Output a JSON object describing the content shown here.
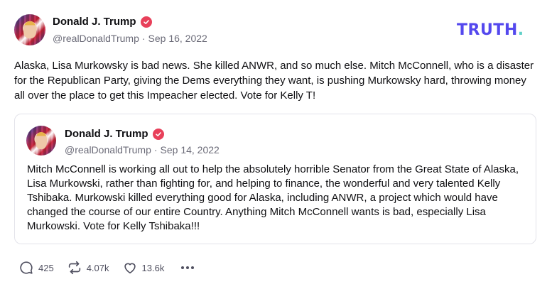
{
  "post": {
    "author_name": "Donald J. Trump",
    "handle": "@realDonaldTrump",
    "separator": "·",
    "date": "Sep 16, 2022",
    "text": "Alaska, Lisa Murkowsky is bad news. She killed ANWR, and so much else. Mitch McConnell, who is a disaster for the Republican Party, giving the Dems everything they want, is pushing Murkowsky hard, throwing money all over the place to get this Impeacher elected. Vote for Kelly T!"
  },
  "brand": {
    "logo_text": "TRUTH",
    "logo_dot": ".",
    "logo_color": "#5448ee",
    "dot_color": "#5fd0c8"
  },
  "quoted_post": {
    "author_name": "Donald J. Trump",
    "handle": "@realDonaldTrump",
    "separator": "·",
    "date": "Sep 14, 2022",
    "text": "Mitch McConnell is working all out to help the absolutely horrible Senator from the Great State of Alaska, Lisa Murkowski, rather than fighting for, and helping to finance, the wonderful and very talented Kelly Tshibaka. Murkowski killed everything good for Alaska, including ANWR, a project which would have changed the course of our entire Country. Anything Mitch McConnell wants is bad, especially Lisa Murkowski. Vote for Kelly Tshibaka!!!"
  },
  "actions": {
    "replies": "425",
    "retruths": "4.07k",
    "likes": "13.6k"
  },
  "icons": {
    "verified": "verified-badge-icon",
    "reply": "comment-icon",
    "retruth": "retruth-icon",
    "like": "heart-icon",
    "more": "more-dots-icon"
  },
  "colors": {
    "verified": "#e8405a",
    "muted_text": "#6b6b78"
  }
}
